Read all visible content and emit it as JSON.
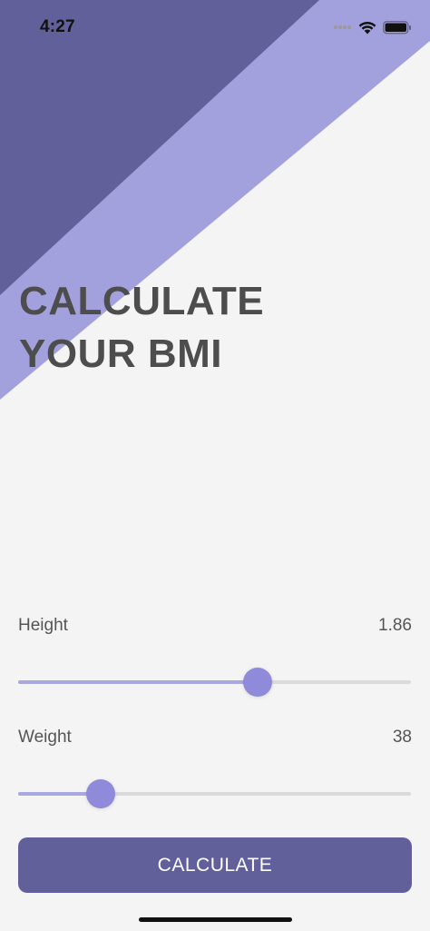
{
  "status_bar": {
    "time": "4:27"
  },
  "title": {
    "line1": "CALCULATE",
    "line2": "YOUR BMI"
  },
  "height": {
    "label": "Height",
    "value": "1.86",
    "slider_fraction": 0.61
  },
  "weight": {
    "label": "Weight",
    "value": "38",
    "slider_fraction": 0.21
  },
  "button": {
    "label": "CALCULATE"
  },
  "colors": {
    "background": "#f4f4f4",
    "dark_purple": "#62609b",
    "light_purple": "#a3a1dd",
    "thumb": "#8f8ada",
    "track_fill": "#aaa8e0",
    "track": "#dadada",
    "text": "#4d4d4d"
  },
  "icons": {
    "cellular": "cellular-dots-icon",
    "wifi": "wifi-icon",
    "battery": "battery-icon"
  }
}
